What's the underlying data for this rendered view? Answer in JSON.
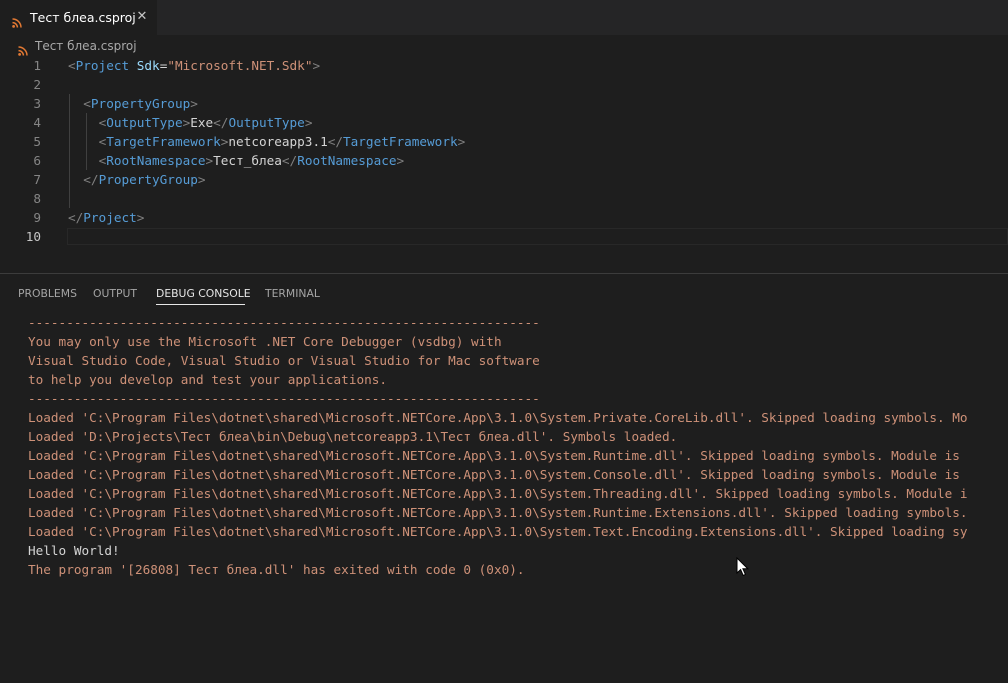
{
  "tab": {
    "title": "Тест блеа.csproj",
    "icon": "rss-file-icon",
    "close_glyph": "✕"
  },
  "breadcrumb": {
    "label": "Тест блеа.csproj"
  },
  "editor": {
    "line_numbers": [
      "1",
      "2",
      "3",
      "4",
      "5",
      "6",
      "7",
      "8",
      "9",
      "10"
    ],
    "lines": [
      [
        {
          "t": "<",
          "c": "tg"
        },
        {
          "t": "Project",
          "c": "tn"
        },
        {
          "t": " ",
          "c": "tx"
        },
        {
          "t": "Sdk",
          "c": "an"
        },
        {
          "t": "=",
          "c": "tx"
        },
        {
          "t": "\"Microsoft.NET.Sdk\"",
          "c": "av"
        },
        {
          "t": ">",
          "c": "tg"
        }
      ],
      [],
      [
        {
          "t": "  ",
          "c": "tx"
        },
        {
          "t": "<",
          "c": "tg"
        },
        {
          "t": "PropertyGroup",
          "c": "tn"
        },
        {
          "t": ">",
          "c": "tg"
        }
      ],
      [
        {
          "t": "    ",
          "c": "tx"
        },
        {
          "t": "<",
          "c": "tg"
        },
        {
          "t": "OutputType",
          "c": "tn"
        },
        {
          "t": ">",
          "c": "tg"
        },
        {
          "t": "Exe",
          "c": "tx"
        },
        {
          "t": "</",
          "c": "tg"
        },
        {
          "t": "OutputType",
          "c": "tn"
        },
        {
          "t": ">",
          "c": "tg"
        }
      ],
      [
        {
          "t": "    ",
          "c": "tx"
        },
        {
          "t": "<",
          "c": "tg"
        },
        {
          "t": "TargetFramework",
          "c": "tn"
        },
        {
          "t": ">",
          "c": "tg"
        },
        {
          "t": "netcoreapp3.1",
          "c": "tx"
        },
        {
          "t": "</",
          "c": "tg"
        },
        {
          "t": "TargetFramework",
          "c": "tn"
        },
        {
          "t": ">",
          "c": "tg"
        }
      ],
      [
        {
          "t": "    ",
          "c": "tx"
        },
        {
          "t": "<",
          "c": "tg"
        },
        {
          "t": "RootNamespace",
          "c": "tn"
        },
        {
          "t": ">",
          "c": "tg"
        },
        {
          "t": "Тест_блеа",
          "c": "tx"
        },
        {
          "t": "</",
          "c": "tg"
        },
        {
          "t": "RootNamespace",
          "c": "tn"
        },
        {
          "t": ">",
          "c": "tg"
        }
      ],
      [
        {
          "t": "  ",
          "c": "tx"
        },
        {
          "t": "</",
          "c": "tg"
        },
        {
          "t": "PropertyGroup",
          "c": "tn"
        },
        {
          "t": ">",
          "c": "tg"
        }
      ],
      [],
      [
        {
          "t": "</",
          "c": "tg"
        },
        {
          "t": "Project",
          "c": "tn"
        },
        {
          "t": ">",
          "c": "tg"
        }
      ],
      []
    ]
  },
  "panel": {
    "tabs": [
      "PROBLEMS",
      "OUTPUT",
      "DEBUG CONSOLE",
      "TERMINAL"
    ],
    "active_tab": "DEBUG CONSOLE"
  },
  "console": {
    "lines": [
      {
        "text": "-------------------------------------------------------------------",
        "kind": "stderr"
      },
      {
        "text": "You may only use the Microsoft .NET Core Debugger (vsdbg) with",
        "kind": "stderr"
      },
      {
        "text": "Visual Studio Code, Visual Studio or Visual Studio for Mac software",
        "kind": "stderr"
      },
      {
        "text": "to help you develop and test your applications.",
        "kind": "stderr"
      },
      {
        "text": "-------------------------------------------------------------------",
        "kind": "stderr"
      },
      {
        "text": "Loaded 'C:\\Program Files\\dotnet\\shared\\Microsoft.NETCore.App\\3.1.0\\System.Private.CoreLib.dll'. Skipped loading symbols. Mo",
        "kind": "stderr"
      },
      {
        "text": "Loaded 'D:\\Projects\\Тест блеа\\bin\\Debug\\netcoreapp3.1\\Тест блеа.dll'. Symbols loaded.",
        "kind": "stderr"
      },
      {
        "text": "Loaded 'C:\\Program Files\\dotnet\\shared\\Microsoft.NETCore.App\\3.1.0\\System.Runtime.dll'. Skipped loading symbols. Module is",
        "kind": "stderr"
      },
      {
        "text": "Loaded 'C:\\Program Files\\dotnet\\shared\\Microsoft.NETCore.App\\3.1.0\\System.Console.dll'. Skipped loading symbols. Module is",
        "kind": "stderr"
      },
      {
        "text": "Loaded 'C:\\Program Files\\dotnet\\shared\\Microsoft.NETCore.App\\3.1.0\\System.Threading.dll'. Skipped loading symbols. Module i",
        "kind": "stderr"
      },
      {
        "text": "Loaded 'C:\\Program Files\\dotnet\\shared\\Microsoft.NETCore.App\\3.1.0\\System.Runtime.Extensions.dll'. Skipped loading symbols.",
        "kind": "stderr"
      },
      {
        "text": "Loaded 'C:\\Program Files\\dotnet\\shared\\Microsoft.NETCore.App\\3.1.0\\System.Text.Encoding.Extensions.dll'. Skipped loading sy",
        "kind": "stderr"
      },
      {
        "text": "Hello World!",
        "kind": "stdout"
      },
      {
        "text": "The program '[26808] Тест блеа.dll' has exited with code 0 (0x0).",
        "kind": "stderr"
      }
    ]
  },
  "colors": {
    "background": "#1e1e1e",
    "console_stderr": "#ce9178",
    "console_stdout": "#d4d4d4",
    "xml_tag": "#569cd6",
    "xml_bracket": "#808080",
    "xml_attr": "#9cdcfe",
    "xml_value": "#ce9178",
    "rss_icon": "#e37933"
  }
}
